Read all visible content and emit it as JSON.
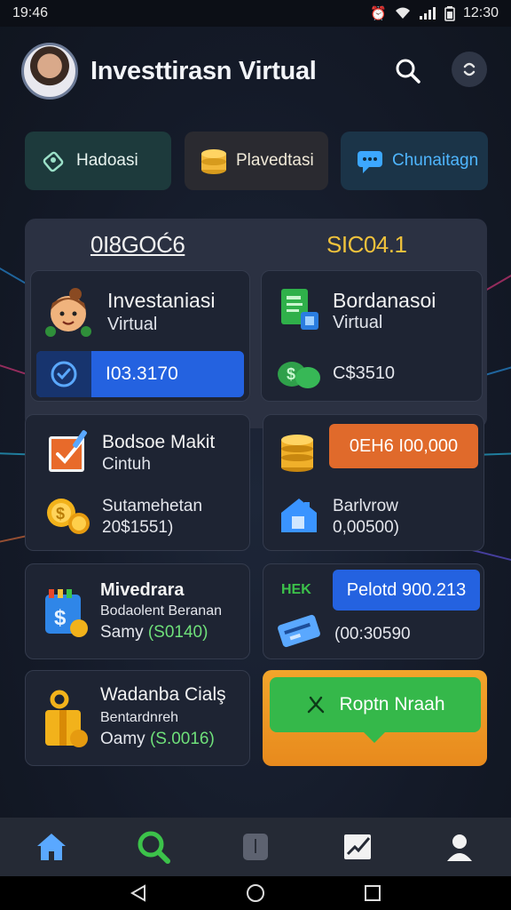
{
  "status_bar": {
    "time_left": "19:46",
    "time_right": "12:30"
  },
  "header": {
    "title": "Investtirasn Virtual"
  },
  "actions": [
    {
      "label": "Hadoasi",
      "icon": "pen-badge-icon"
    },
    {
      "label": "Plavedtasi",
      "icon": "coin-stack-icon"
    },
    {
      "label": "Chunaitagn",
      "icon": "chat-bubble-icon"
    }
  ],
  "panel": {
    "left_value": "0I8GOĆ6",
    "right_value": "SIC04.1",
    "cards": {
      "c1": {
        "title": "Investaniasi",
        "sub": "Virtual",
        "value": "I03.3170"
      },
      "c2": {
        "title": "Bordanasoi",
        "sub": "Virtual",
        "value": "C$3510"
      }
    }
  },
  "cards": {
    "c3": {
      "title": "Bodsoe Makit",
      "sub": "Cintuh",
      "line1": "Sutamehetan",
      "line2": "20$1551)"
    },
    "c4": {
      "badge": "0EH6 I00,000",
      "line1": "Barlvrow",
      "line2": "0,00500)"
    },
    "c5": {
      "title": "Mivedrara",
      "line1": "Bodaolent Beranan",
      "line2_prefix": "Samy ",
      "line2_value": "(S0140)"
    },
    "c6": {
      "tag": "HEK",
      "badge": "Pelotd 900.213",
      "line1": "(00:30590"
    },
    "c7": {
      "title": "Wadanba Cialş",
      "line1": "Bentardnreh",
      "line2_prefix": "Oamy ",
      "line2_value": "(S.0016)"
    },
    "cta": {
      "label": "Roptn Nraah"
    }
  },
  "colors": {
    "accent_blue": "#2462e0",
    "accent_orange": "#e06a2b",
    "accent_green": "#3cc24a",
    "gold": "#f0c23c"
  }
}
